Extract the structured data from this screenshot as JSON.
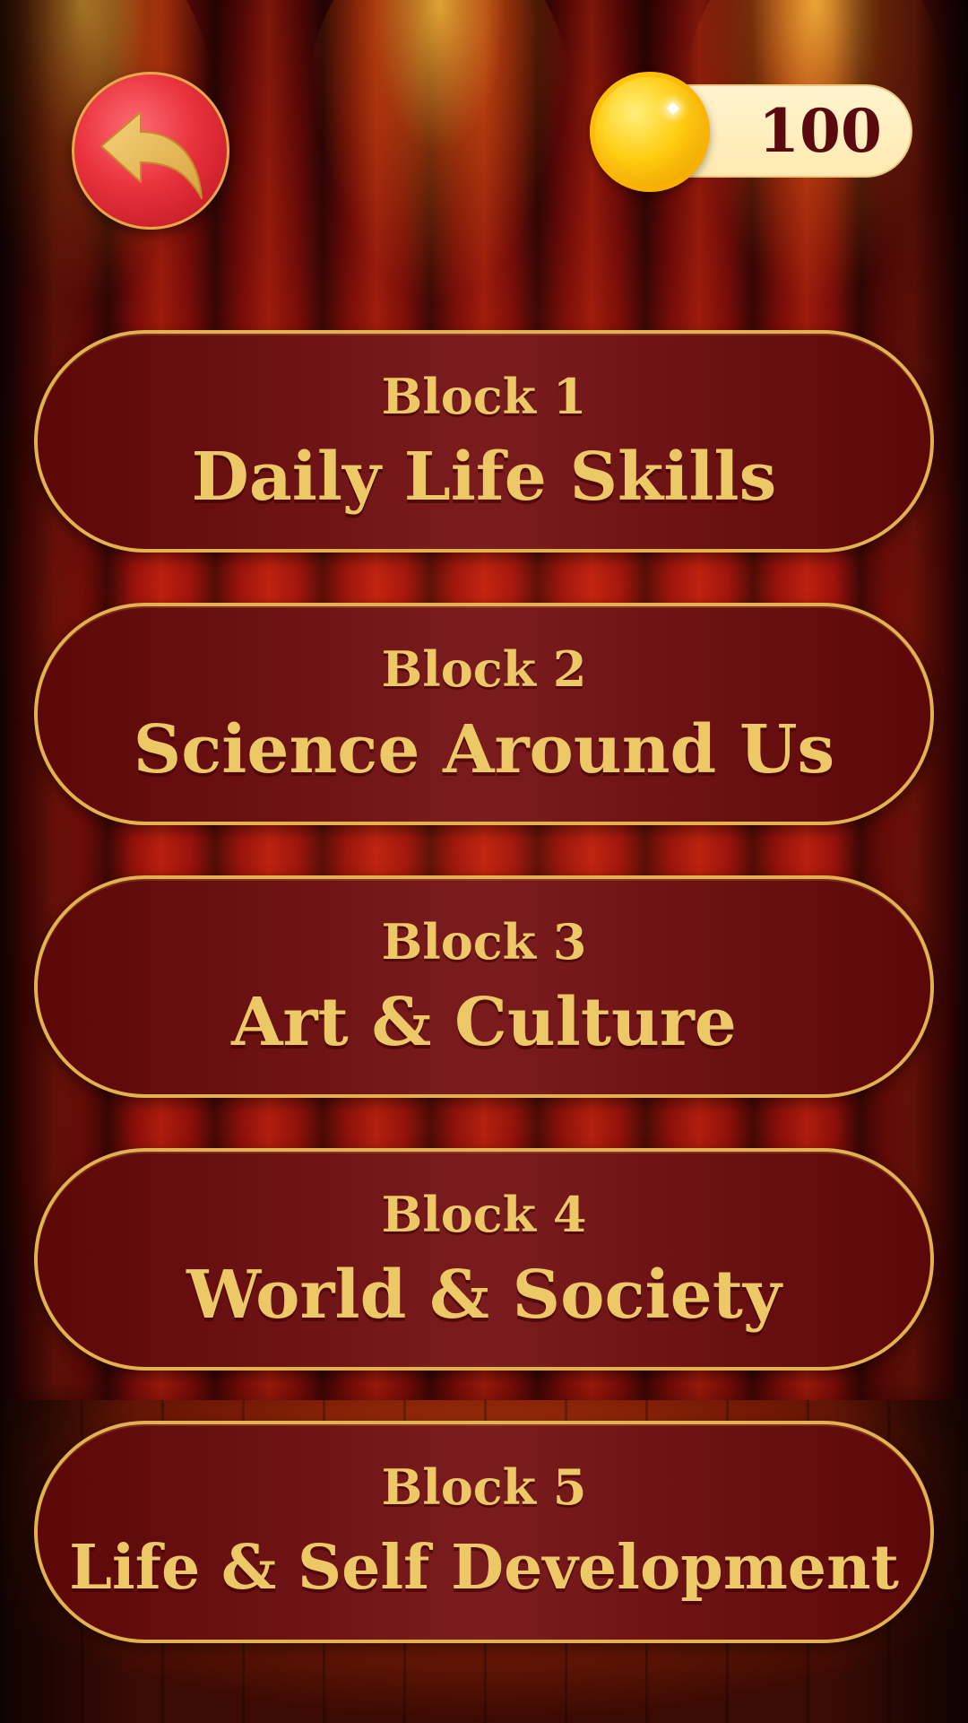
{
  "header": {
    "back_icon": "back-arrow-icon",
    "coin_icon": "gold-coin-icon",
    "coins": "100"
  },
  "blocks": [
    {
      "label": "Block 1",
      "title": "Daily Life Skills"
    },
    {
      "label": "Block 2",
      "title": "Science Around Us"
    },
    {
      "label": "Block 3",
      "title": "Art & Culture"
    },
    {
      "label": "Block 4",
      "title": "World & Society"
    },
    {
      "label": "Block 5",
      "title": "Life & Self Development"
    }
  ],
  "colors": {
    "button_fill": "#6b1012",
    "button_border": "#e2b24e",
    "button_text": "#ecc866",
    "back_button": "#e8323c",
    "coin_pill": "#fff1c6",
    "coin_text": "#5a0a0e"
  }
}
